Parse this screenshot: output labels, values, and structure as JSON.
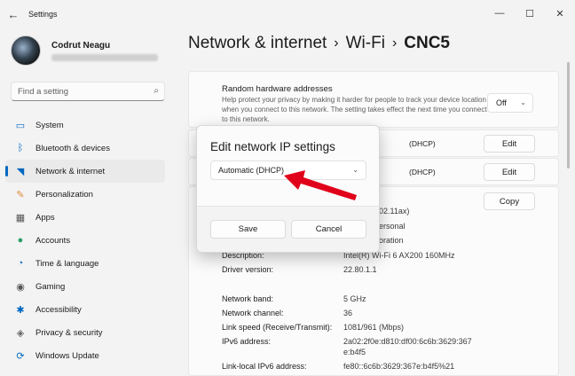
{
  "window": {
    "title": "Settings",
    "controls": {
      "minimize": "—",
      "maximize": "☐",
      "close": "✕"
    }
  },
  "profile": {
    "name": "Codrut Neagu"
  },
  "search": {
    "placeholder": "Find a setting"
  },
  "nav": {
    "items": [
      {
        "label": "System",
        "icon": "monitor-icon",
        "glyph": "▭",
        "color": "#0067c0"
      },
      {
        "label": "Bluetooth & devices",
        "icon": "bluetooth-icon",
        "glyph": "ᛒ",
        "color": "#0067c0"
      },
      {
        "label": "Network & internet",
        "icon": "wifi-icon",
        "glyph": "◥",
        "color": "#0067c0"
      },
      {
        "label": "Personalization",
        "icon": "brush-icon",
        "glyph": "✎",
        "color": "#e28a3b"
      },
      {
        "label": "Apps",
        "icon": "apps-icon",
        "glyph": "▦",
        "color": "#555555"
      },
      {
        "label": "Accounts",
        "icon": "person-icon",
        "glyph": "●",
        "color": "#2aa06a"
      },
      {
        "label": "Time & language",
        "icon": "globe-clock-icon",
        "glyph": "◔",
        "color": "#0067c0"
      },
      {
        "label": "Gaming",
        "icon": "gamepad-icon",
        "glyph": "◉",
        "color": "#555555"
      },
      {
        "label": "Accessibility",
        "icon": "accessibility-icon",
        "glyph": "✱",
        "color": "#0067c0"
      },
      {
        "label": "Privacy & security",
        "icon": "shield-icon",
        "glyph": "◈",
        "color": "#666666"
      },
      {
        "label": "Windows Update",
        "icon": "update-icon",
        "glyph": "⟳",
        "color": "#0067c0"
      }
    ],
    "active_index": 2
  },
  "breadcrumb": {
    "part1": "Network & internet",
    "sep": "›",
    "part2": "Wi-Fi",
    "current": "CNC5"
  },
  "random_hw": {
    "title": "Random hardware addresses",
    "description": "Help protect your privacy by making it harder for people to track your device location when you connect to this network. The setting takes effect the next time you connect to this network.",
    "value": "Off"
  },
  "rows": [
    {
      "value": "(DHCP)",
      "button": "Edit"
    },
    {
      "value": "(DHCP)",
      "button": "Edit"
    }
  ],
  "props": {
    "copy_label": "Copy",
    "partial": [
      {
        "value": "02.11ax)"
      },
      {
        "value": "ersonal"
      },
      {
        "value": "oration"
      }
    ],
    "items": [
      {
        "label": "Description:",
        "value": "Intel(R) Wi-Fi 6 AX200 160MHz"
      },
      {
        "label": "Driver version:",
        "value": "22.80.1.1"
      },
      {
        "label": "Network band:",
        "value": "5 GHz"
      },
      {
        "label": "Network channel:",
        "value": "36"
      },
      {
        "label": "Link speed (Receive/Transmit):",
        "value": "1081/961 (Mbps)"
      },
      {
        "label": "IPv6 address:",
        "value": "2a02:2f0e:d810:df00:6c6b:3629:367"
      },
      {
        "label": "",
        "value": "e:b4f5"
      },
      {
        "label": "Link-local IPv6 address:",
        "value": "fe80::6c6b:3629:367e:b4f5%21"
      }
    ]
  },
  "dialog": {
    "title": "Edit network IP settings",
    "selected": "Automatic (DHCP)",
    "save": "Save",
    "cancel": "Cancel"
  },
  "colors": {
    "accent": "#0067c0",
    "arrow": "#e0001a"
  }
}
